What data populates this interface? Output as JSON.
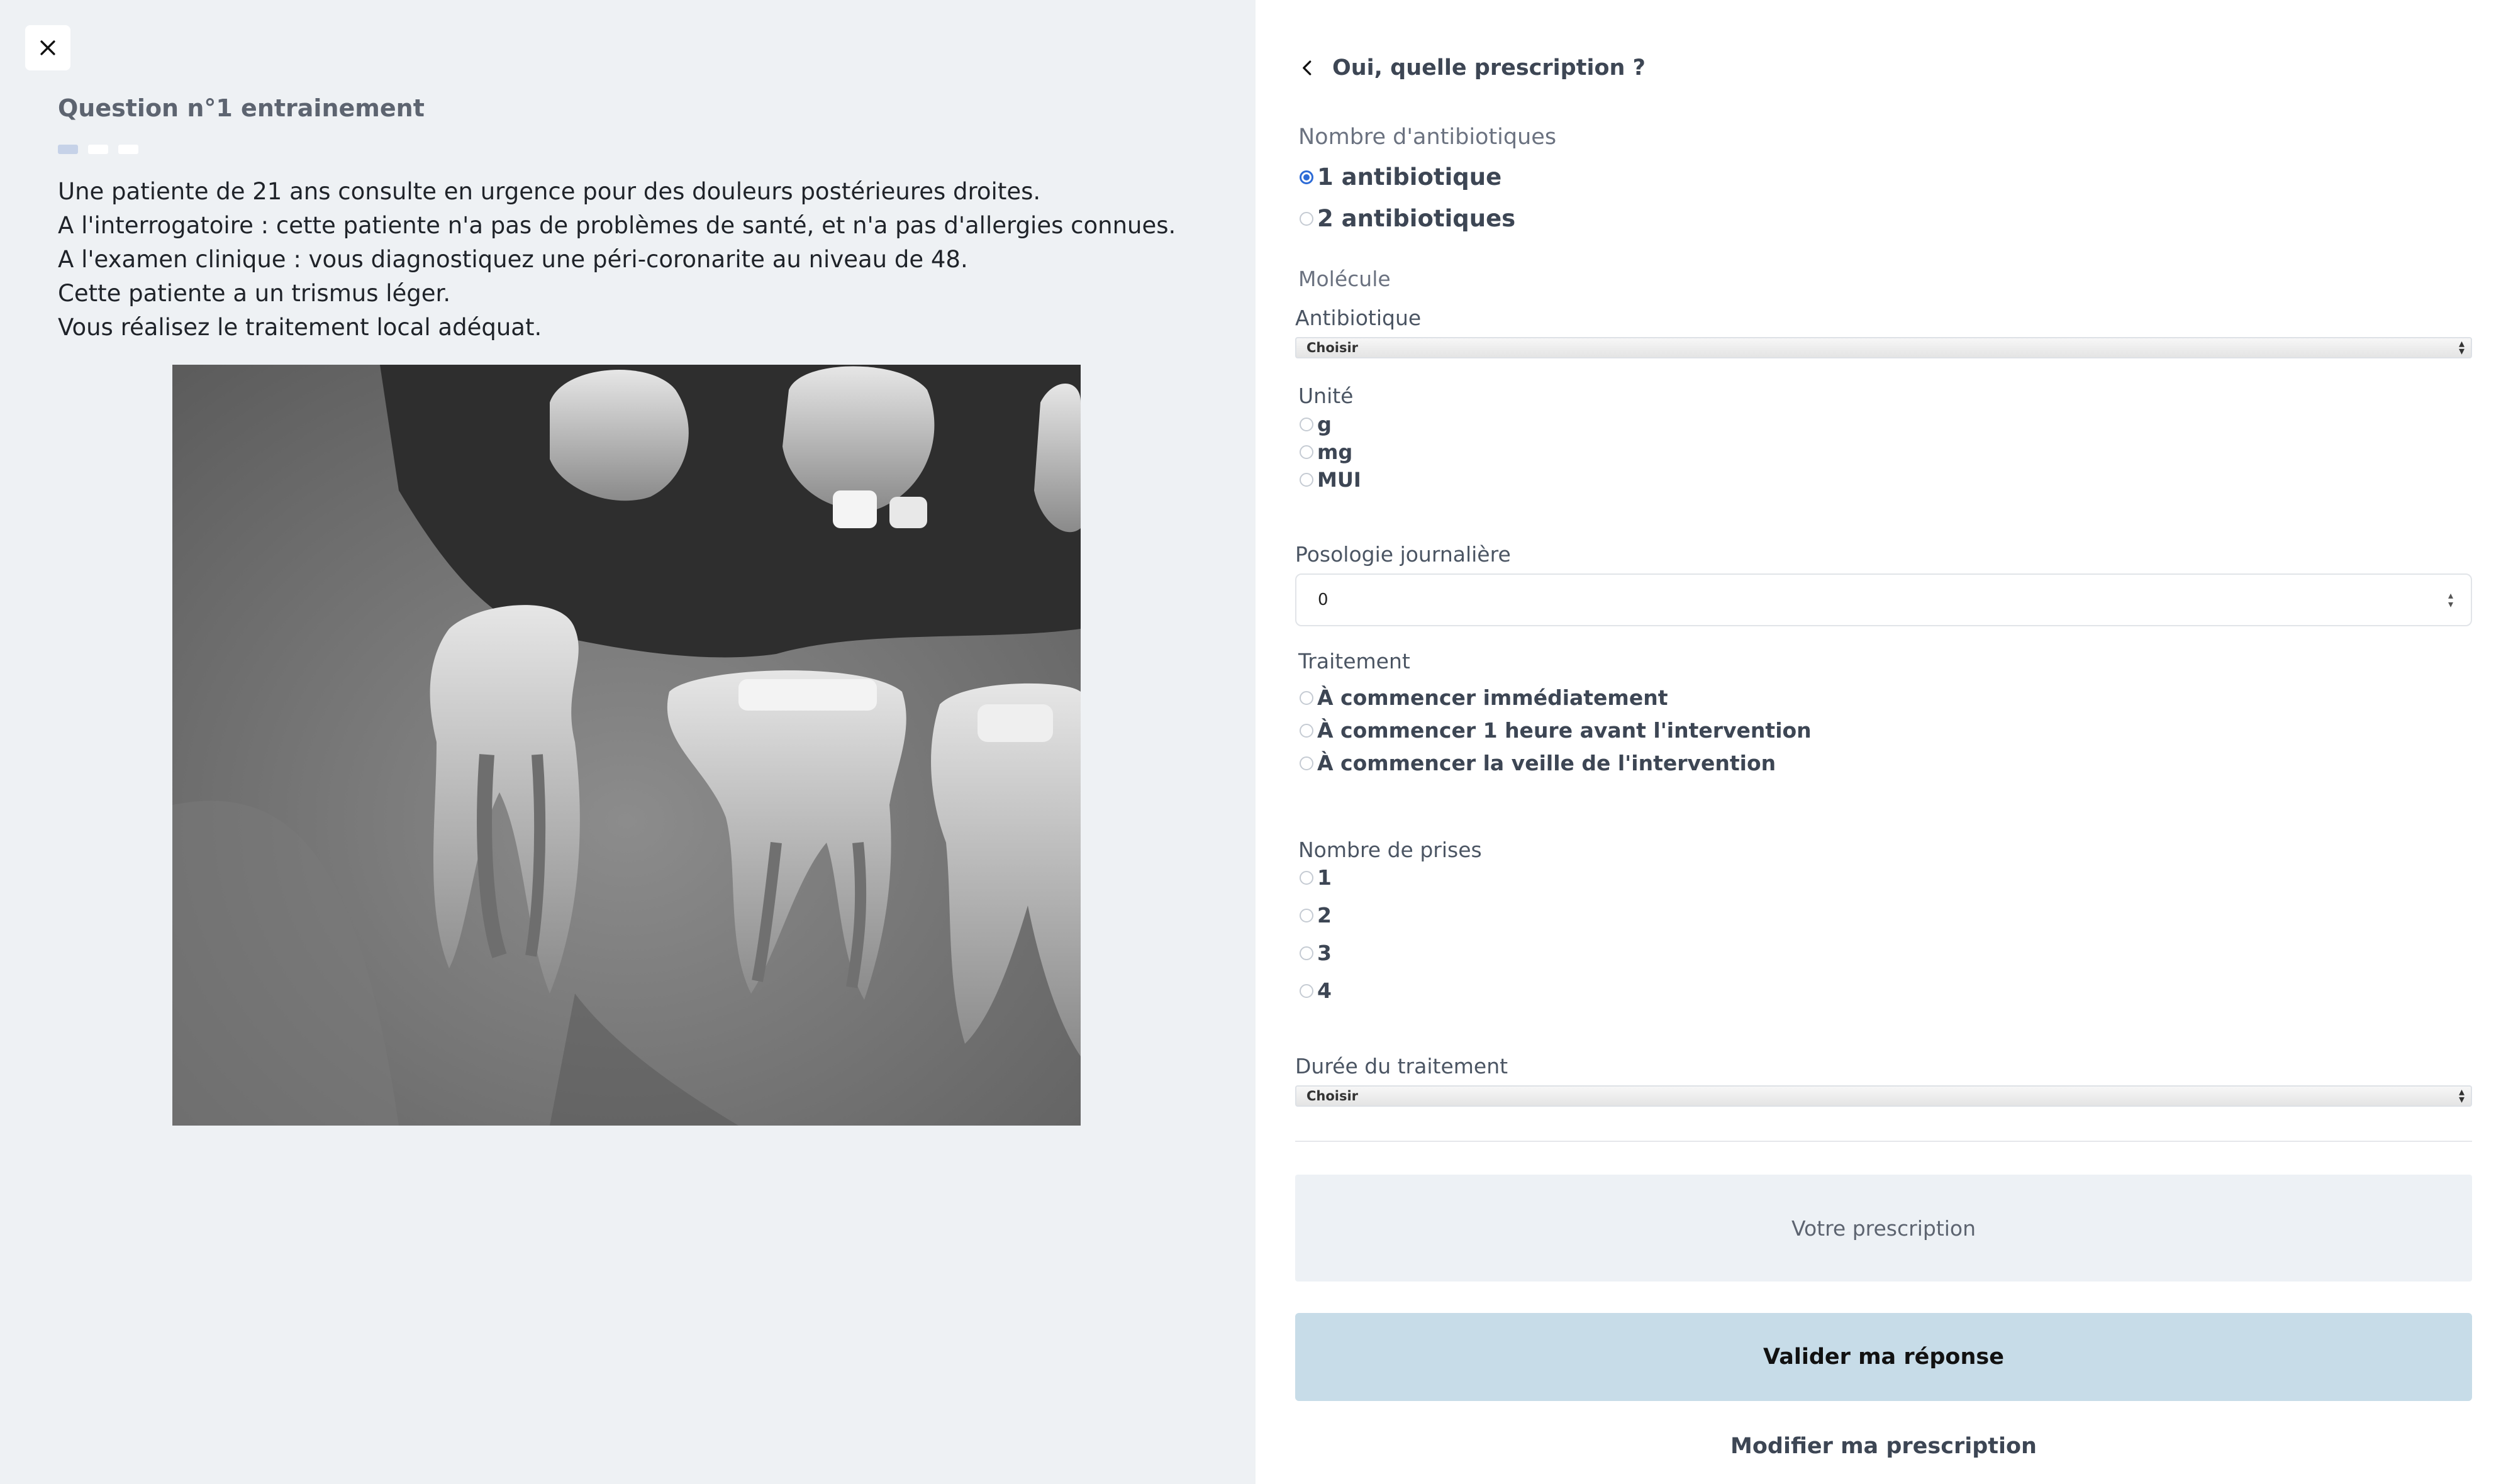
{
  "question": {
    "title": "Question n°1 entrainement",
    "progress_steps": 3,
    "progress_current": 1,
    "lines": [
      "Une patiente de 21 ans consulte en urgence pour des douleurs postérieures droites.",
      "A l'interrogatoire : cette patiente n'a pas de problèmes de santé, et n'a pas d'allergies connues.",
      "A l'examen clinique : vous diagnostiquez une péri-coronarite au niveau de 48.",
      "Cette patiente a un trismus léger.",
      "Vous réalisez le traitement local adéquat."
    ]
  },
  "panel": {
    "back_title": "Oui, quelle prescription ?"
  },
  "antibiotic_count": {
    "label": "Nombre d'antibiotiques",
    "options": [
      "1 antibiotique",
      "2 antibiotiques"
    ],
    "selected_index": 0
  },
  "molecule": {
    "section_label": "Molécule",
    "field_label": "Antibiotique",
    "select_value": "Choisir"
  },
  "unit": {
    "label": "Unité",
    "options": [
      "g",
      "mg",
      "MUI"
    ]
  },
  "dosage": {
    "label": "Posologie journalière",
    "value": "0"
  },
  "treatment": {
    "label": "Traitement",
    "options": [
      "À commencer immédiatement",
      "À commencer 1 heure avant l'intervention",
      "À commencer la veille de l'intervention"
    ]
  },
  "intakes": {
    "label": "Nombre de prises",
    "options": [
      "1",
      "2",
      "3",
      "4"
    ]
  },
  "duration": {
    "label": "Durée du traitement",
    "select_value": "Choisir"
  },
  "prescription_box": "Votre prescription",
  "validate_label": "Valider ma réponse",
  "modify_label": "Modifier ma prescription",
  "colors": {
    "left_bg": "#eef1f4",
    "validate_bg": "#c7dce8",
    "radio_accent": "#2d6bd6"
  }
}
